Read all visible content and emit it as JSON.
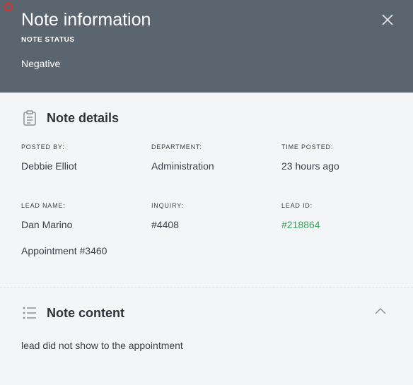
{
  "header": {
    "title": "Note information",
    "status_label": "NOTE STATUS",
    "status_value": "Negative",
    "close_icon": "close-icon",
    "record_indicator_color": "#e0302a",
    "background_color": "#5b6570"
  },
  "details": {
    "title": "Note details",
    "icon": "clipboard-icon",
    "posted_by": {
      "label": "POSTED BY:",
      "value": "Debbie Elliot"
    },
    "department": {
      "label": "DEPARTMENT:",
      "value": "Administration"
    },
    "time_posted": {
      "label": "TIME POSTED:",
      "value": "23 hours ago"
    },
    "lead_name": {
      "label": "LEAD NAME:",
      "value": "Dan Marino"
    },
    "inquiry": {
      "label": "INQUIRY:",
      "value": "#4408"
    },
    "lead_id": {
      "label": "LEAD ID:",
      "value": "#218864"
    },
    "appointment": "Appointment #3460",
    "link_color": "#3aa35a"
  },
  "content": {
    "title": "Note content",
    "icon": "list-icon",
    "collapse_icon": "chevron-up-icon",
    "text": "lead did not show to the appointment"
  }
}
